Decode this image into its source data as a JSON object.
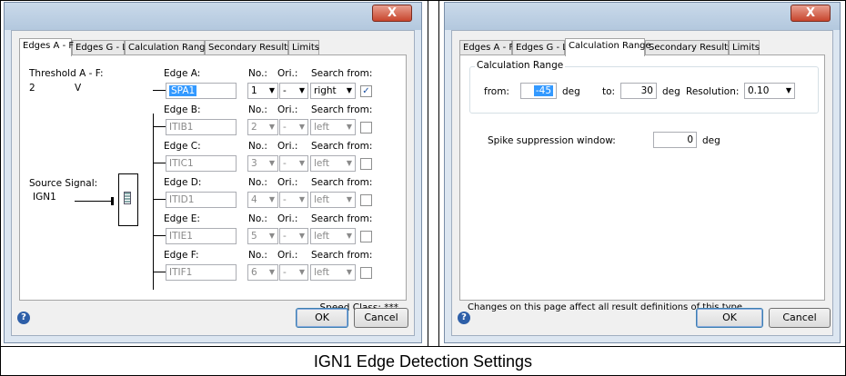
{
  "caption": "IGN1 Edge Detection Settings",
  "left": {
    "close_label": "X",
    "tabs": [
      "Edges A - F",
      "Edges G - L",
      "Calculation Range",
      "Secondary Results",
      "Limits"
    ],
    "threshold_label": "Threshold A - F:",
    "threshold_value": "2",
    "threshold_unit": "V",
    "source_label": "Source Signal:",
    "source_value": "IGN1",
    "col_no": "No.:",
    "col_ori": "Ori.:",
    "col_search": "Search from:",
    "edges": [
      {
        "label": "Edge A:",
        "name": "SPA1",
        "no": "1",
        "ori": "-",
        "search": "right",
        "checked": "✓"
      },
      {
        "label": "Edge B:",
        "name": "ITIB1",
        "no": "2",
        "ori": "-",
        "search": "left",
        "checked": ""
      },
      {
        "label": "Edge C:",
        "name": "ITIC1",
        "no": "3",
        "ori": "-",
        "search": "left",
        "checked": ""
      },
      {
        "label": "Edge D:",
        "name": "ITID1",
        "no": "4",
        "ori": "-",
        "search": "left",
        "checked": ""
      },
      {
        "label": "Edge E:",
        "name": "ITIE1",
        "no": "5",
        "ori": "-",
        "search": "left",
        "checked": ""
      },
      {
        "label": "Edge F:",
        "name": "ITIF1",
        "no": "6",
        "ori": "-",
        "search": "left",
        "checked": ""
      }
    ],
    "speed_class": "Speed Class: ***",
    "ok_label": "OK",
    "cancel_label": "Cancel"
  },
  "right": {
    "close_label": "X",
    "tabs": [
      "Edges A - F",
      "Edges G - L",
      "Calculation Range",
      "Secondary Results",
      "Limits"
    ],
    "group_label": "Calculation Range",
    "from_label": "from:",
    "from_value": "-45",
    "deg1": "deg",
    "to_label": "to:",
    "to_value": "30",
    "deg2": "deg",
    "resolution_label": "Resolution:",
    "resolution_value": "0.10",
    "spike_label": "Spike suppression window:",
    "spike_value": "0",
    "deg3": "deg",
    "note": "Changes on this page affect all result definitions of this type.",
    "ok_label": "OK",
    "cancel_label": "Cancel"
  }
}
